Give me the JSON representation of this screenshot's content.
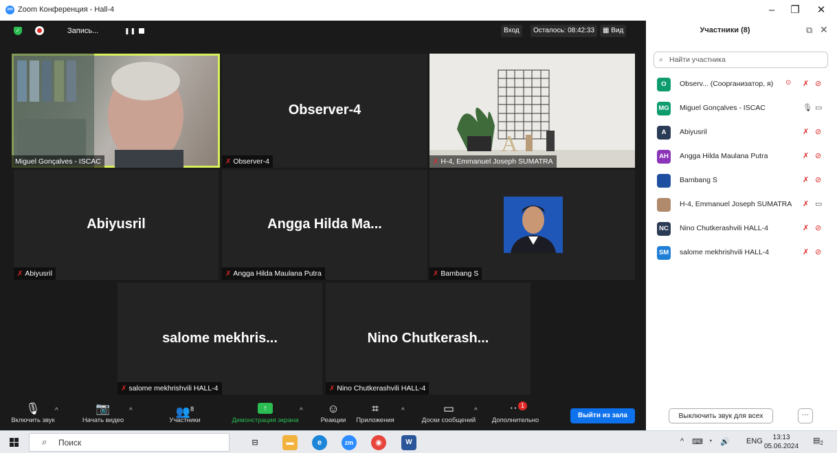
{
  "window": {
    "title": "Zoom Конференция - Hall-4",
    "logo": "zm",
    "controls": [
      "–",
      "❐",
      "✕"
    ]
  },
  "topbar": {
    "recording_label": "Запись...",
    "enter_label": "Вход",
    "remaining_label": "Осталось: 08:42:33",
    "view_label": "Вид"
  },
  "tiles": [
    {
      "id": "miguel",
      "big_name": "",
      "tag": "Miguel Gonçalves - ISCAC",
      "muted": false,
      "video": true
    },
    {
      "id": "observer",
      "big_name": "Observer-4",
      "tag": "Observer-4",
      "muted": true,
      "video": false
    },
    {
      "id": "emmanuel",
      "big_name": "",
      "tag": "H-4, Emmanuel Joseph SUMATRA",
      "muted": true,
      "video": true
    },
    {
      "id": "abiyusril",
      "big_name": "Abiyusril",
      "tag": "Abiyusril",
      "muted": true,
      "video": false
    },
    {
      "id": "angga",
      "big_name": "Angga Hilda Ma...",
      "tag": "Angga Hilda Maulana Putra",
      "muted": true,
      "video": false
    },
    {
      "id": "bambang",
      "big_name": "",
      "tag": "Bambang S",
      "muted": true,
      "video": false
    },
    {
      "id": "salome",
      "big_name": "salome mekhris...",
      "tag": "salome mekhrishvili HALL-4",
      "muted": true,
      "video": false
    },
    {
      "id": "nino",
      "big_name": "Nino Chutkerash...",
      "tag": "Nino Chutkerashvili HALL-4",
      "muted": true,
      "video": false
    }
  ],
  "toolbar": {
    "audio_label": "Включить звук",
    "video_label": "Начать видео",
    "participants_label": "Участники",
    "participants_count": "8",
    "share_label": "Демонстрация экрана",
    "reactions_label": "Реакции",
    "apps_label": "Приложения",
    "boards_label": "Доски сообщений",
    "more_label": "Дополнительно",
    "more_badge": "1",
    "leave_label": "Выйти из зала"
  },
  "panel": {
    "title": "Участники (8)",
    "search_placeholder": "Найти участника",
    "participants": [
      {
        "initials": "O",
        "name": "Observ... (Соорганизатор, я)",
        "color": "#0e9c6e",
        "mic_on": false,
        "cam_on": false,
        "recording": true
      },
      {
        "initials": "MG",
        "name": "Miguel Gonçalves - ISCAC",
        "color": "#0e9c6e",
        "mic_on": true,
        "cam_on": true,
        "recording": false
      },
      {
        "initials": "A",
        "name": "Abiyusril",
        "color": "#2a3b55",
        "mic_on": false,
        "cam_on": false,
        "recording": false
      },
      {
        "initials": "AH",
        "name": "Angga Hilda Maulana Putra",
        "color": "#8a34b8",
        "mic_on": false,
        "cam_on": false,
        "recording": false
      },
      {
        "initials": "",
        "name": "Bambang S",
        "color": "#1f4fa0",
        "mic_on": false,
        "cam_on": false,
        "recording": false
      },
      {
        "initials": "",
        "name": "H-4, Emmanuel Joseph SUMATRA",
        "color": "#b08a6a",
        "mic_on": false,
        "cam_on": true,
        "recording": false
      },
      {
        "initials": "NC",
        "name": "Nino Chutkerashvili HALL-4",
        "color": "#2a3b55",
        "mic_on": false,
        "cam_on": false,
        "recording": false
      },
      {
        "initials": "SM",
        "name": "salome mekhrishvili HALL-4",
        "color": "#1f7fd6",
        "mic_on": false,
        "cam_on": false,
        "recording": false
      }
    ],
    "mute_all_label": "Выключить звук для всех",
    "more_label": "···"
  },
  "taskbar": {
    "search_label": "Поиск",
    "lang": "ENG",
    "time": "13:13",
    "date": "05.06.2024",
    "notif_count": "2"
  }
}
